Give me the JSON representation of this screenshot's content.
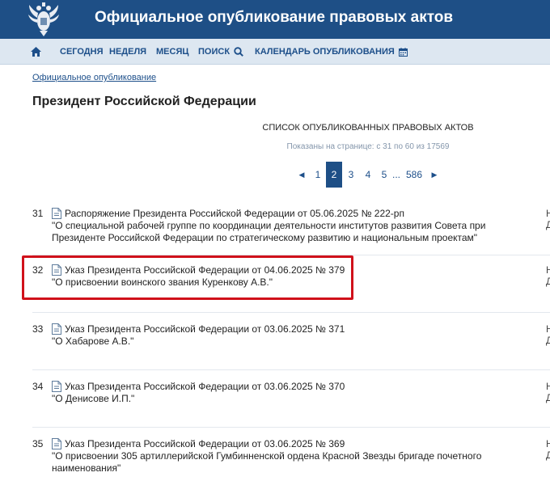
{
  "header": {
    "title": "Официальное опубликование правовых актов"
  },
  "nav": {
    "today": "СЕГОДНЯ",
    "week": "НЕДЕЛЯ",
    "month": "МЕСЯЦ",
    "search": "ПОИСК",
    "calendar": "КАЛЕНДАРЬ ОПУБЛИКОВАНИЯ"
  },
  "breadcrumb": "Официальное опубликование",
  "page_title": "Президент Российской Федерации",
  "list": {
    "title": "СПИСОК ОПУБЛИКОВАННЫХ ПРАВОВЫХ АКТОВ",
    "shown": "Показаны на странице: с 31 по 60 из 17569"
  },
  "pagination": {
    "prev": "◀",
    "p1": "1",
    "p2": "2",
    "p3": "3",
    "p4": "4",
    "p5": "5",
    "dots": "...",
    "last": "586",
    "next": "▶",
    "active_page": "2"
  },
  "colors": {
    "header_bg": "#1e4f86",
    "nav_bg": "#dde7f1",
    "link": "#1d4f8a",
    "highlight": "#d0111b"
  },
  "acts": [
    {
      "num": "31",
      "title": "Распоряжение Президента Российской Федерации от 05.06.2025 № 222-рп",
      "desc": "\"О специальной рабочей группе по координации деятельности институтов развития Совета при Президенте Российской Федерации по стратегическому развитию и национальным проектам\"",
      "side1": "Н",
      "side2": "Д"
    },
    {
      "num": "32",
      "title": "Указ Президента Российской Федерации от 04.06.2025 № 379",
      "desc": "\"О присвоении воинского звания Куренкову А.В.\"",
      "side1": "Н",
      "side2": "Д",
      "highlighted": true
    },
    {
      "num": "33",
      "title": "Указ Президента Российской Федерации от 03.06.2025 № 371",
      "desc": "\"О Хабарове А.В.\"",
      "side1": "Н",
      "side2": "Д"
    },
    {
      "num": "34",
      "title": "Указ Президента Российской Федерации от 03.06.2025 № 370",
      "desc": "\"О Денисове И.П.\"",
      "side1": "Н",
      "side2": "Д"
    },
    {
      "num": "35",
      "title": "Указ Президента Российской Федерации от 03.06.2025 № 369",
      "desc": "\"О присвоении 305 артиллерийской Гумбинненской ордена Красной Звезды бригаде почетного наименования\"",
      "side1": "Н",
      "side2": "Д"
    }
  ]
}
